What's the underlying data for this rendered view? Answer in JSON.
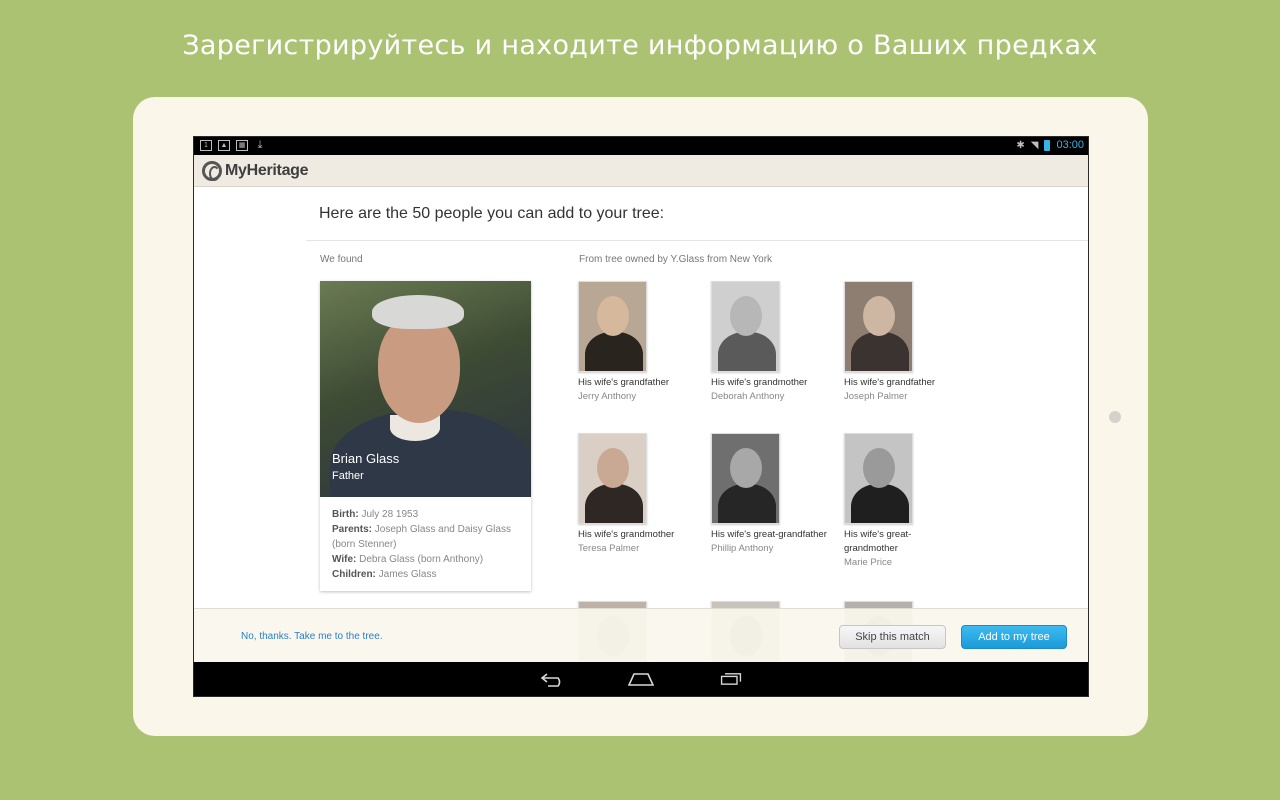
{
  "headline": "Зарегистрируйтесь и находите информацию о Ваших предках",
  "status_bar": {
    "time": "03:00"
  },
  "app": {
    "name": "MyHeritage"
  },
  "page": {
    "title": "Here are the 50 people you can add to your tree:",
    "we_found": "We found",
    "from_tree": "From tree owned by Y.Glass from New York"
  },
  "person": {
    "name": "Brian Glass",
    "relation": "Father",
    "birth_label": "Birth:",
    "birth": "July 28 1953",
    "parents_label": "Parents:",
    "parents": "Joseph Glass and Daisy Glass (born Stenner)",
    "wife_label": "Wife:",
    "wife": "Debra Glass (born Anthony)",
    "children_label": "Children:",
    "children": "James Glass"
  },
  "relatives": [
    {
      "relation": "His wife's grandfather",
      "name": "Jerry Anthony"
    },
    {
      "relation": "His wife's grandmother",
      "name": "Deborah Anthony"
    },
    {
      "relation": "His wife's grandfather",
      "name": "Joseph Palmer"
    },
    {
      "relation": "His wife's grandmother",
      "name": "Teresa Palmer"
    },
    {
      "relation": "His wife's great-grandfather",
      "name": "Phillip Anthony"
    },
    {
      "relation": "His wife's great-grandmother",
      "name": "Marie Price"
    }
  ],
  "footer": {
    "no_thanks": "No, thanks. Take me to the tree.",
    "skip": "Skip this match",
    "add": "Add to my tree"
  }
}
